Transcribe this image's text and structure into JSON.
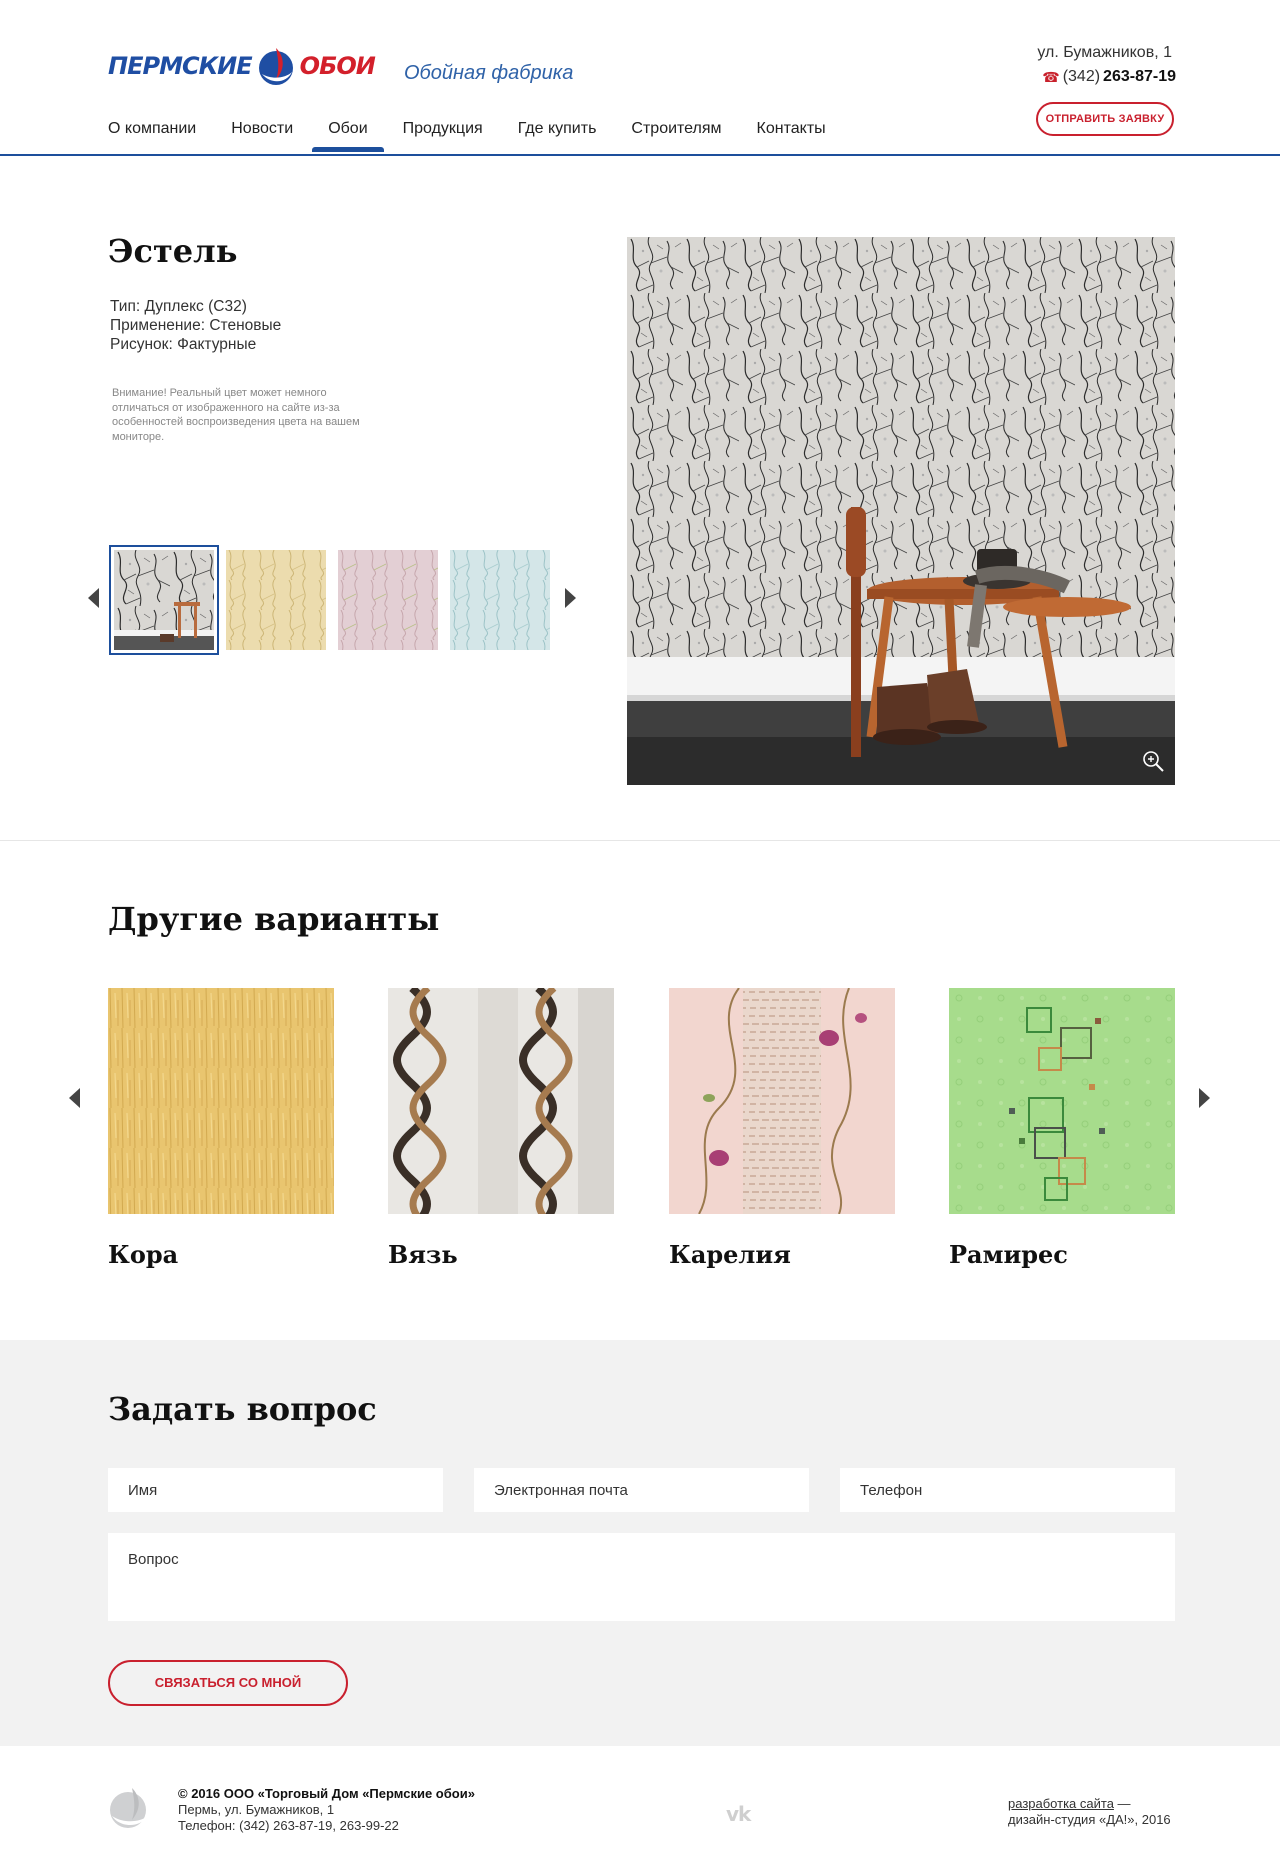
{
  "header": {
    "logo_part1": "ПЕРМСКИЕ",
    "logo_part2": "ОБОИ",
    "tagline": "Обойная фабрика",
    "address": "ул. Бумажников, 1",
    "phone_code": "(342)",
    "phone_number": "263-87-19",
    "order_button": "ОТПРАВИТЬ ЗАЯВКУ",
    "nav": [
      "О компании",
      "Новости",
      "Обои",
      "Продукция",
      "Где купить",
      "Строителям",
      "Контакты"
    ],
    "active_nav": "Обои"
  },
  "product": {
    "title": "Эстель",
    "type": "Тип: Дуплекс (С32)",
    "usage": "Применение: Стеновые",
    "pattern": "Рисунок: Фактурные",
    "warning": "Внимание! Реальный цвет может немного отличаться от изображенного на сайте из-за особенностей воспроизведения цвета на вашем мониторе.",
    "thumbnails": [
      "gray-interior",
      "yellow",
      "pink",
      "light-blue"
    ],
    "selected_thumbnail": 0
  },
  "variants": {
    "title": "Другие варианты",
    "items": [
      {
        "name": "Кора"
      },
      {
        "name": "Вязь"
      },
      {
        "name": "Карелия"
      },
      {
        "name": "Рамирес"
      }
    ]
  },
  "question": {
    "title": "Задать вопрос",
    "name_placeholder": "Имя",
    "email_placeholder": "Электронная почта",
    "phone_placeholder": "Телефон",
    "question_placeholder": "Вопрос",
    "submit": "СВЯЗАТЬСЯ СО МНОЙ"
  },
  "footer": {
    "copyright": "© 2016 ООО «Торговый Дом «Пермские обои»",
    "address": "Пермь, ул. Бумажников, 1",
    "phones": "Телефон: (342) 263-87-19, 263-99-22",
    "vk": "vk",
    "dev_link": "разработка сайта",
    "dev_dash": " —",
    "dev_studio": "дизайн-студия «ДА!», 2016"
  },
  "colors": {
    "brand_blue": "#1d4f9c",
    "brand_red": "#c9202e",
    "form_bg": "#f2f2f2"
  }
}
